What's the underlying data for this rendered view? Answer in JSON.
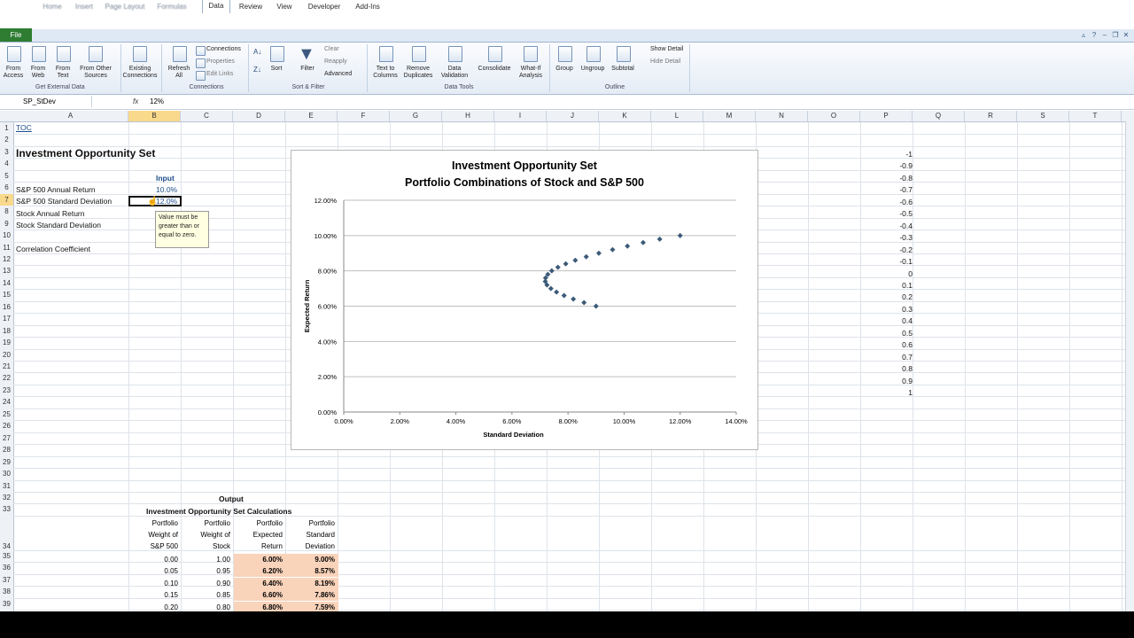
{
  "ribbon_tabs": [
    "File",
    "Home",
    "Insert",
    "Page Layout",
    "Formulas",
    "Data",
    "Review",
    "View",
    "Developer",
    "Add-Ins"
  ],
  "active_tab": "Data",
  "ribbon": {
    "get_external": {
      "from_access": "From\nAccess",
      "from_web": "From\nWeb",
      "from_text": "From\nText",
      "from_other": "From Other\nSources",
      "group": "Get External Data"
    },
    "existing": "Existing\nConnections",
    "refresh": "Refresh\nAll",
    "connections_list": [
      "Connections",
      "Properties",
      "Edit Links"
    ],
    "connections_group": "Connections",
    "sort": "Sort",
    "filter": "Filter",
    "filter_list": [
      "Clear",
      "Reapply",
      "Advanced"
    ],
    "sort_group": "Sort & Filter",
    "text_to_columns": "Text to\nColumns",
    "remove_dup": "Remove\nDuplicates",
    "data_validation": "Data\nValidation",
    "consolidate": "Consolidate",
    "what_if": "What-If\nAnalysis",
    "data_tools_group": "Data Tools",
    "group": "Group",
    "ungroup": "Ungroup",
    "subtotal": "Subtotal",
    "outline_list": [
      "Show Detail",
      "Hide Detail"
    ],
    "outline_group": "Outline"
  },
  "formula_bar": {
    "name_box": "SP_StDev",
    "fx": "fx",
    "value": "12%"
  },
  "columns": [
    "A",
    "B",
    "C",
    "D",
    "E",
    "F",
    "G",
    "H",
    "I",
    "J",
    "K",
    "L",
    "M",
    "N",
    "O",
    "P",
    "Q",
    "R",
    "S",
    "T"
  ],
  "rows": [
    "1",
    "2",
    "3",
    "4",
    "5",
    "6",
    "7",
    "8",
    "9",
    "10",
    "11",
    "12",
    "13",
    "14",
    "15",
    "16",
    "17",
    "18",
    "19",
    "20",
    "21",
    "22",
    "23",
    "24",
    "25",
    "26",
    "27",
    "28",
    "29",
    "30",
    "31",
    "32",
    "33",
    "34",
    "35",
    "36",
    "37",
    "38",
    "39"
  ],
  "sheet": {
    "toc": "TOC",
    "title": "Investment Opportunity Set",
    "input_header": "Input",
    "labels": [
      "S&P 500 Annual Return",
      "S&P 500 Standard Deviation",
      "Stock Annual Return",
      "Stock Standard Deviation",
      "",
      "Correlation Coefficient"
    ],
    "sp_return": "10.0%",
    "sp_stdev": "12.0%",
    "tooltip": "Value must be greater than or equal to zero.",
    "correlations": [
      "-1",
      "-0.9",
      "-0.8",
      "-0.7",
      "-0.6",
      "-0.5",
      "-0.4",
      "-0.3",
      "-0.2",
      "-0.1",
      "0",
      "0.1",
      "0.2",
      "0.3",
      "0.4",
      "0.5",
      "0.6",
      "0.7",
      "0.8",
      "0.9",
      "1"
    ],
    "output_header": "Output",
    "calc_title": "Investment Opportunity Set Calculations",
    "table_headers": [
      "Portfolio\nWeight of\nS&P 500",
      "Portfolio\nWeight of\nStock",
      "Portfolio\nExpected\nReturn",
      "Portfolio\nStandard\nDeviation"
    ],
    "table_rows": [
      [
        "0.00",
        "1.00",
        "6.00%",
        "9.00%"
      ],
      [
        "0.05",
        "0.95",
        "6.20%",
        "8.57%"
      ],
      [
        "0.10",
        "0.90",
        "6.40%",
        "8.19%"
      ],
      [
        "0.15",
        "0.85",
        "6.60%",
        "7.86%"
      ],
      [
        "0.20",
        "0.80",
        "6.80%",
        "7.59%"
      ]
    ]
  },
  "chart_data": {
    "type": "scatter",
    "title": "Investment Opportunity Set",
    "subtitle": "Portfolio Combinations of Stock and S&P 500",
    "xlabel": "Standard Deviation",
    "ylabel": "Expected Return",
    "xlim": [
      0,
      14
    ],
    "ylim": [
      0,
      12
    ],
    "x_ticks": [
      "0.00%",
      "2.00%",
      "4.00%",
      "6.00%",
      "8.00%",
      "10.00%",
      "12.00%",
      "14.00%"
    ],
    "y_ticks": [
      "0.00%",
      "2.00%",
      "4.00%",
      "6.00%",
      "8.00%",
      "10.00%",
      "12.00%"
    ],
    "grid": true,
    "marker_color": "#3b5b78",
    "x": [
      9.0,
      8.57,
      8.19,
      7.86,
      7.59,
      7.39,
      7.25,
      7.19,
      7.2,
      7.28,
      7.42,
      7.64,
      7.92,
      8.26,
      8.65,
      9.1,
      9.59,
      10.12,
      10.68,
      11.27,
      12.0
    ],
    "y": [
      6.0,
      6.2,
      6.4,
      6.6,
      6.8,
      7.0,
      7.2,
      7.4,
      7.6,
      7.8,
      8.0,
      8.2,
      8.4,
      8.6,
      8.8,
      9.0,
      9.2,
      9.4,
      9.6,
      9.8,
      10.0
    ]
  }
}
